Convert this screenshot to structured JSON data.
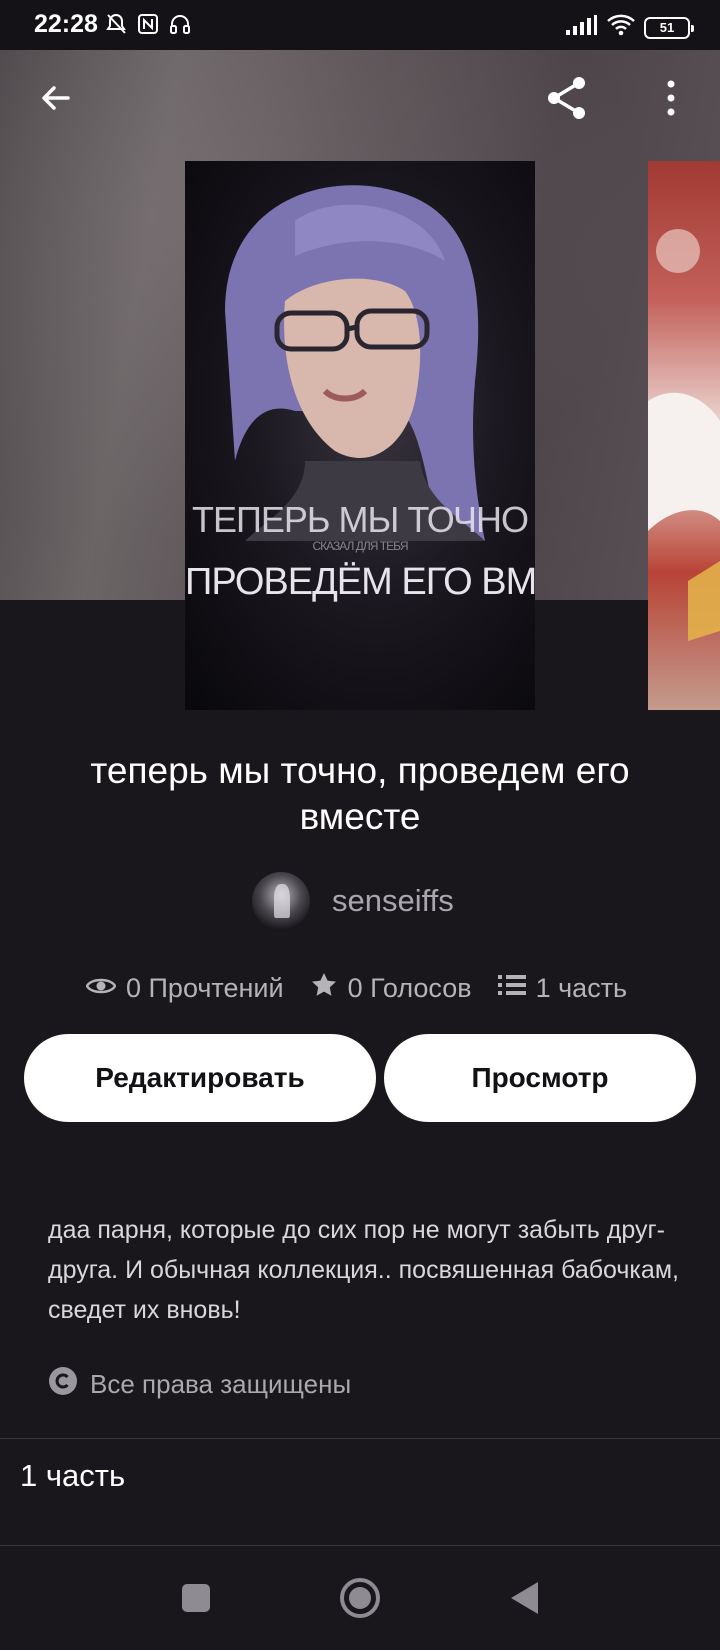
{
  "status_bar": {
    "time": "22:28",
    "battery": "51",
    "icons": [
      "bell-muted-icon",
      "nfc-icon",
      "headset-icon",
      "signal-icon",
      "wifi-icon",
      "battery-icon"
    ]
  },
  "topbar": {
    "back_icon": "arrow-left-icon",
    "share_icon": "share-icon",
    "menu_icon": "more-vertical-icon"
  },
  "cover": {
    "line1": "ТЕПЕРЬ МЫ ТОЧНО",
    "sub": "СКАЗАЛ ДЛЯ ТЕБЯ",
    "line2": "ПРОВЕДЁМ ЕГО ВМЕСТЕ"
  },
  "story": {
    "title": "теперь мы точно, проведем его вместе",
    "author": "senseiffs",
    "stats": {
      "reads": "0 Прочтений",
      "votes": "0 Голосов",
      "parts": "1 часть"
    },
    "description": "даа парня, которые до сих пор не могут забыть друг-друга. И обычная коллекция.. посвяшенная бабочкам, сведет их вновь!",
    "rights": "Все права защищены"
  },
  "buttons": {
    "edit": "Редактировать",
    "view": "Просмотр"
  },
  "parts_list": {
    "label": "1 часть"
  },
  "navbar": {
    "icons": [
      "square-icon",
      "circle-home-icon",
      "triangle-back-icon"
    ]
  },
  "colors": {
    "background": "#19171b",
    "button_bg": "#ffffff",
    "muted_text": "#b5b2b8"
  }
}
